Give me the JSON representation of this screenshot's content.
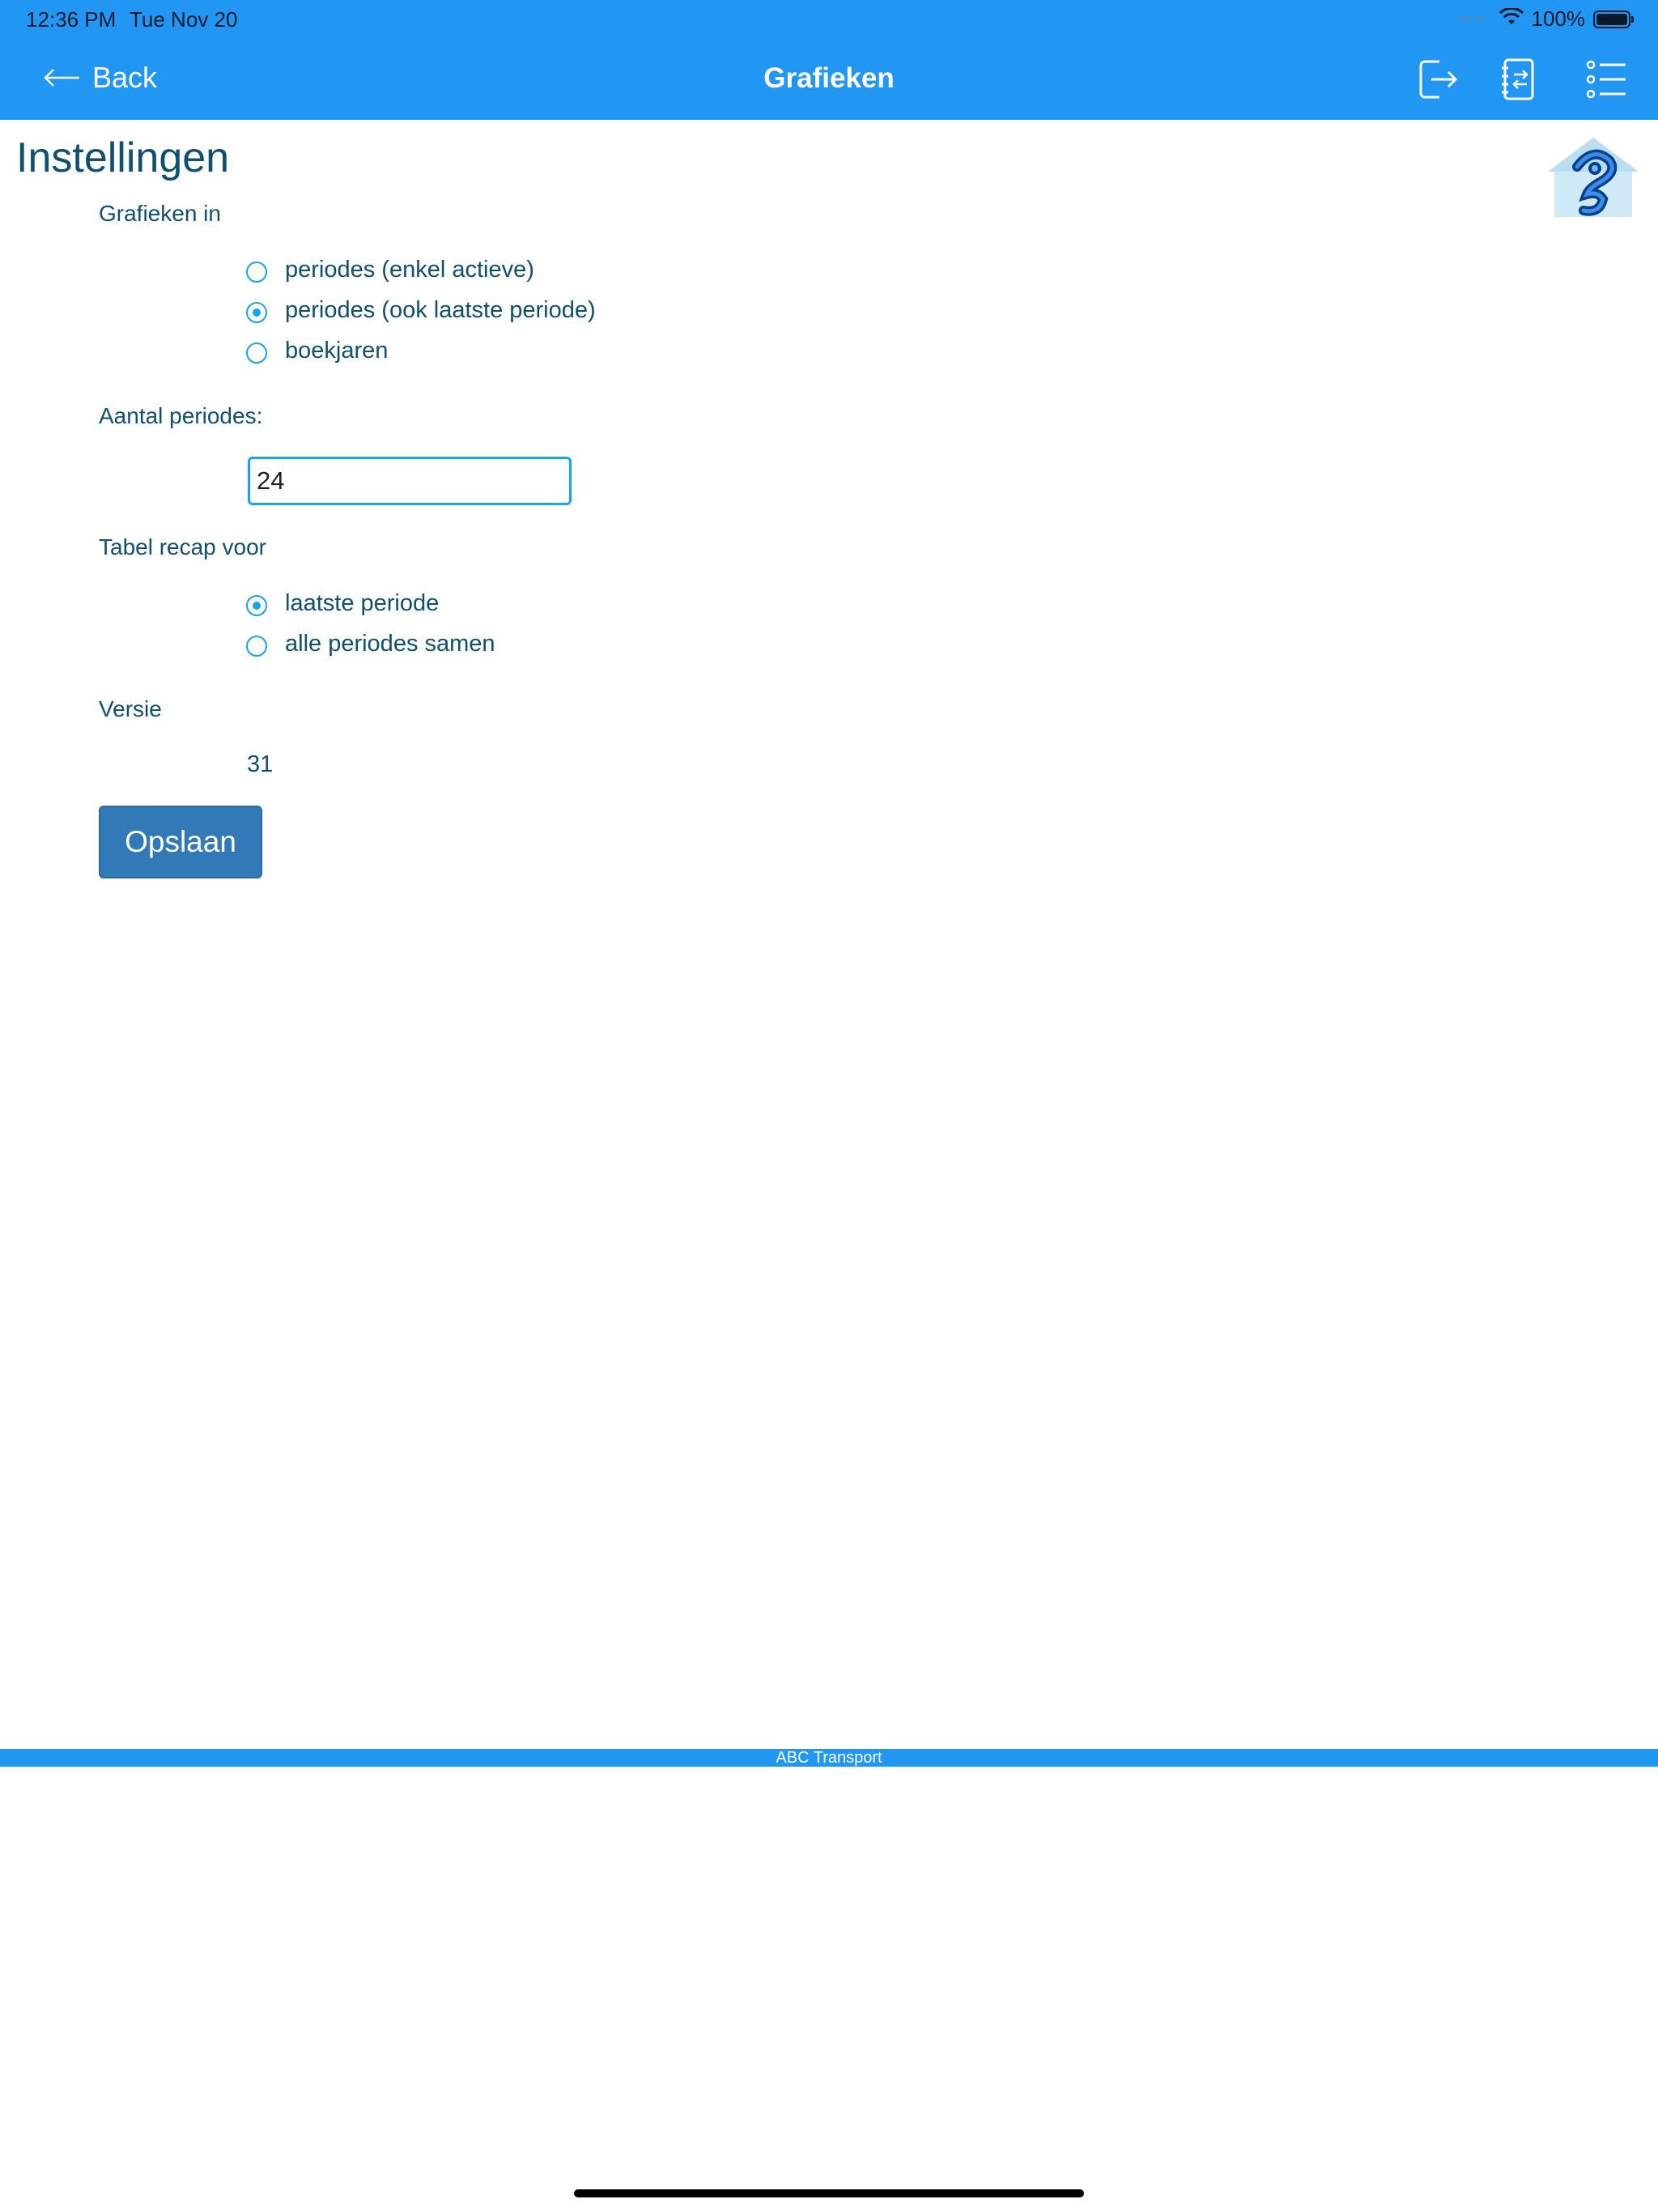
{
  "status_bar": {
    "time": "12:36 PM",
    "date": "Tue Nov 20",
    "signal_dots": "••••",
    "battery_text": "100%"
  },
  "nav": {
    "back_label": "Back",
    "title": "Grafieken",
    "icons": [
      "logout-icon",
      "swap-ledger-icon",
      "list-menu-icon"
    ]
  },
  "page": {
    "title": "Instellingen"
  },
  "sections": {
    "grafieken_in": {
      "label": "Grafieken in",
      "options": [
        {
          "label": "periodes (enkel actieve)",
          "checked": false
        },
        {
          "label": "periodes (ook laatste periode)",
          "checked": true
        },
        {
          "label": "boekjaren",
          "checked": false
        }
      ]
    },
    "aantal_periodes": {
      "label": "Aantal periodes:",
      "value": "24"
    },
    "tabel_recap": {
      "label": "Tabel recap voor",
      "options": [
        {
          "label": "laatste periode",
          "checked": true
        },
        {
          "label": "alle periodes samen",
          "checked": false
        }
      ]
    },
    "versie": {
      "label": "Versie",
      "value": "31"
    }
  },
  "save_button": {
    "label": "Opslaan"
  },
  "footer": {
    "company": "ABC Transport"
  },
  "colors": {
    "bar_blue": "#2196f3",
    "text_teal": "#0f4f6f",
    "radio_blue": "#1aa3e8",
    "button_blue": "#3279b7"
  }
}
